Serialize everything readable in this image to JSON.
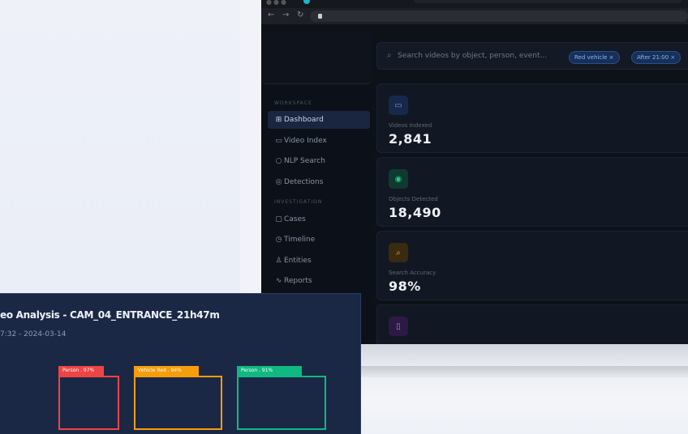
{
  "sidebar": {
    "sections": [
      {
        "label": "WORKSPACE"
      },
      {
        "label": "INVESTIGATION"
      }
    ],
    "items": [
      {
        "label": "Dashboard",
        "icon": "grid-icon"
      },
      {
        "label": "Video Index",
        "icon": "video-icon"
      },
      {
        "label": "NLP Search",
        "icon": "search-icon"
      },
      {
        "label": "Detections",
        "icon": "target-icon"
      },
      {
        "label": "Cases",
        "icon": "folder-icon"
      },
      {
        "label": "Timeline",
        "icon": "clock-icon"
      },
      {
        "label": "Entities",
        "icon": "users-icon"
      },
      {
        "label": "Reports",
        "icon": "activity-icon"
      }
    ]
  },
  "search": {
    "placeholder": "Search videos by object, person, event...",
    "chips": [
      "Red vehicle ×",
      "After 21:00 ×"
    ]
  },
  "stats": [
    {
      "label": "Videos Indexed",
      "value": "2,841",
      "icon": "video-icon",
      "color": "#3b82f6"
    },
    {
      "label": "Objects Detected",
      "value": "18,490",
      "icon": "eye-icon",
      "color": "#10b981"
    },
    {
      "label": "Search Accuracy",
      "value": "98%",
      "icon": "search-icon",
      "color": "#f59e0b"
    },
    {
      "label": "",
      "value": "",
      "icon": "document-icon",
      "color": "#a855f7"
    }
  ],
  "video_card": {
    "title": "eo Analysis - CAM_04_ENTRANCE_21h47m",
    "subtitle": "7:32 - 2024-03-14",
    "detections": [
      {
        "label": "Person . 97%",
        "color": "#ef4444"
      },
      {
        "label": "Vehicle Red . 94%",
        "color": "#f59e0b"
      },
      {
        "label": "Person . 91%",
        "color": "#10b981"
      }
    ]
  }
}
